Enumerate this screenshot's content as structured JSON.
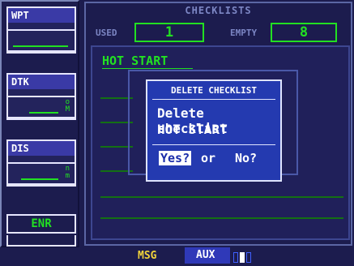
{
  "left_panel": {
    "wpt": {
      "title": "WPT"
    },
    "dtk": {
      "title": "DTK",
      "unit_top": "o",
      "unit_bot": "M"
    },
    "dis": {
      "title": "DIS",
      "unit_top": "n",
      "unit_bot": "m"
    },
    "mode": "ENR"
  },
  "checklists": {
    "title": "CHECKLISTS",
    "used_label": "USED",
    "used_value": "1",
    "empty_label": "EMPTY",
    "empty_value": "8",
    "selected": "HOT START"
  },
  "dialog": {
    "title": "DELETE CHECKLIST",
    "line1": "Delete checklist",
    "line2": "HOT START",
    "yes": "Yes?",
    "or": "or",
    "no": "No?"
  },
  "bottom_bar": {
    "msg": "MSG",
    "aux": "AUX",
    "page_count": 3,
    "active_page": 1
  },
  "colors": {
    "background": "#1c1c4e",
    "green": "#22e022",
    "dialog_blue": "#243ab0",
    "msg_yellow": "#f2d43a"
  }
}
